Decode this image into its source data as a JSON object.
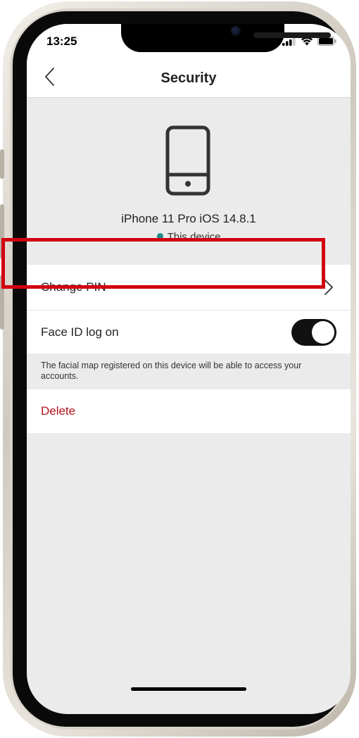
{
  "status_bar": {
    "time": "13:25"
  },
  "nav": {
    "title": "Security"
  },
  "device": {
    "name": "iPhone 11 Pro iOS 14.8.1",
    "status": "This device",
    "status_color": "#1d8a8a"
  },
  "settings": {
    "change_pin_label": "Change PIN",
    "face_id_label": "Face ID log on",
    "face_id_enabled": true,
    "face_id_note": "The facial map registered on this device will be able to access your accounts.",
    "delete_label": "Delete",
    "delete_color": "#b3131b"
  },
  "highlight_color": "#d20011"
}
